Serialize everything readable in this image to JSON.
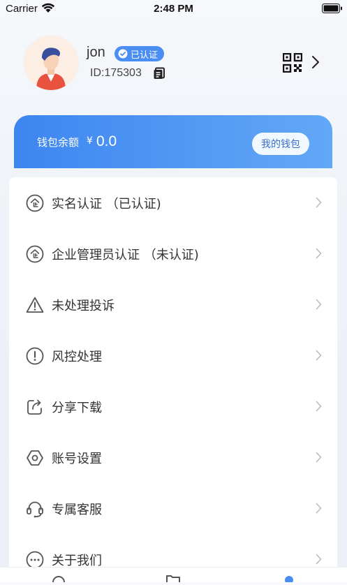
{
  "status_bar": {
    "carrier": "Carrier",
    "time": "2:48 PM"
  },
  "profile": {
    "username": "jon",
    "verified_label": "已认证",
    "user_id": "ID:175303"
  },
  "wallet": {
    "label": "钱包余额",
    "currency": "¥",
    "amount": "0.0",
    "button_label": "我的钱包"
  },
  "menu": {
    "items": [
      {
        "label": "实名认证 （已认证)",
        "icon": "enterprise-badge-icon"
      },
      {
        "label": "企业管理员认证 （未认证)",
        "icon": "enterprise-badge-icon"
      },
      {
        "label": "未处理投诉",
        "icon": "warning-triangle-icon"
      },
      {
        "label": "风控处理",
        "icon": "exclamation-circle-icon"
      },
      {
        "label": "分享下载",
        "icon": "share-icon"
      },
      {
        "label": "账号设置",
        "icon": "hexagon-settings-icon"
      },
      {
        "label": "专属客服",
        "icon": "headset-icon"
      },
      {
        "label": "关于我们",
        "icon": "more-circle-icon"
      }
    ]
  },
  "colors": {
    "accent": "#4a8df3",
    "wallet_gradient_start": "#3d86f0",
    "wallet_gradient_end": "#62a8f7",
    "icon_gray": "#555555",
    "chevron_gray": "#bbbbbb"
  }
}
